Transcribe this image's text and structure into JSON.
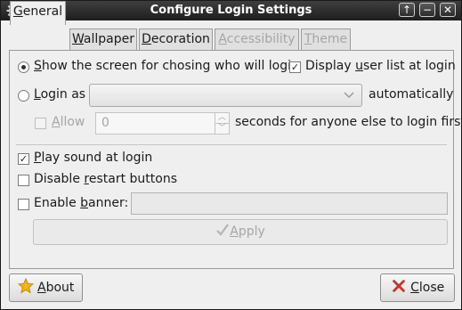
{
  "window": {
    "title": "Configure Login Settings",
    "controls": {
      "up": "↑",
      "minimize": "−",
      "close": "✕"
    }
  },
  "tabs": [
    {
      "label": "General",
      "mnemonic": "G",
      "rest": "eneral",
      "state": "active"
    },
    {
      "label": "Wallpaper",
      "mnemonic": "W",
      "rest": "allpaper",
      "state": "normal"
    },
    {
      "label": "Decoration",
      "mnemonic": "D",
      "rest": "ecoration",
      "state": "normal"
    },
    {
      "label": "Accessibility",
      "mnemonic": "A",
      "rest": "ccessibility",
      "state": "disabled"
    },
    {
      "label": "Theme",
      "mnemonic": "T",
      "rest": "heme",
      "state": "disabled"
    }
  ],
  "general": {
    "show_screen": {
      "mnemonic": "S",
      "rest": "how the screen for chosing who will login",
      "selected": true
    },
    "display_user_list": {
      "prefix": "Display ",
      "mnemonic": "u",
      "rest": "ser list at login",
      "checked": true
    },
    "login_as": {
      "mnemonic": "L",
      "rest": "ogin as",
      "selected": false,
      "user_value": "",
      "suffix": "automatically"
    },
    "allow": {
      "mnemonic": "A",
      "rest": "llow",
      "checked": false,
      "enabled": false,
      "seconds_value": "0",
      "suffix": "seconds for anyone else to login first"
    },
    "play_sound": {
      "mnemonic": "P",
      "rest": "lay sound at login",
      "checked": true
    },
    "disable_restart": {
      "prefix": "Disable ",
      "mnemonic": "r",
      "rest": "estart buttons",
      "checked": false
    },
    "enable_banner": {
      "prefix": "Enable ",
      "mnemonic": "b",
      "rest": "anner:",
      "checked": false,
      "text_value": ""
    },
    "apply_button": {
      "mnemonic": "A",
      "rest": "pply",
      "enabled": false
    }
  },
  "footer": {
    "about_button": {
      "mnemonic": "A",
      "rest": "bout"
    },
    "close_button": {
      "mnemonic": "C",
      "rest": "lose"
    }
  },
  "icons": {
    "app": "gear-icon",
    "about": "star-icon",
    "close": "close-x-icon",
    "apply": "checkmark-icon",
    "dropdown": "chevron-down-icon"
  },
  "colors": {
    "titlebar": "#2b2b2b",
    "window_bg": "#efefef",
    "close_x": "#c0392b",
    "star": "#f2b416"
  }
}
